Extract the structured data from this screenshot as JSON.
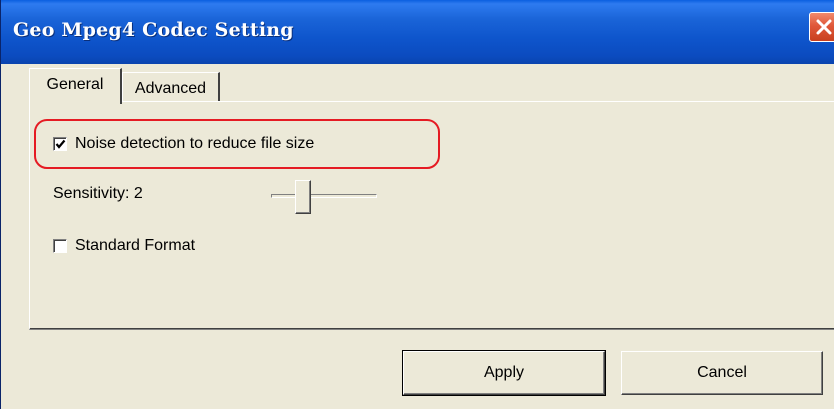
{
  "window": {
    "title": "Geo Mpeg4 Codec Setting"
  },
  "tabs": [
    {
      "label": "General",
      "selected": true
    },
    {
      "label": "Advanced",
      "selected": false
    }
  ],
  "general": {
    "noise_detection": {
      "label": "Noise detection to reduce file size",
      "checked": true
    },
    "sensitivity": {
      "label": "Sensitivity: 2",
      "value": 2,
      "position_fraction": 0.3
    },
    "standard_format": {
      "label": "Standard Format",
      "checked": false
    }
  },
  "buttons": {
    "apply": "Apply",
    "cancel": "Cancel"
  },
  "colors": {
    "titlebar": "#0b4bbf",
    "close_button": "#e0583a",
    "highlight": "#e51b23",
    "dialog_face": "#ece9d8"
  },
  "icons": {
    "close": "close-icon",
    "check": "checkmark-icon"
  }
}
